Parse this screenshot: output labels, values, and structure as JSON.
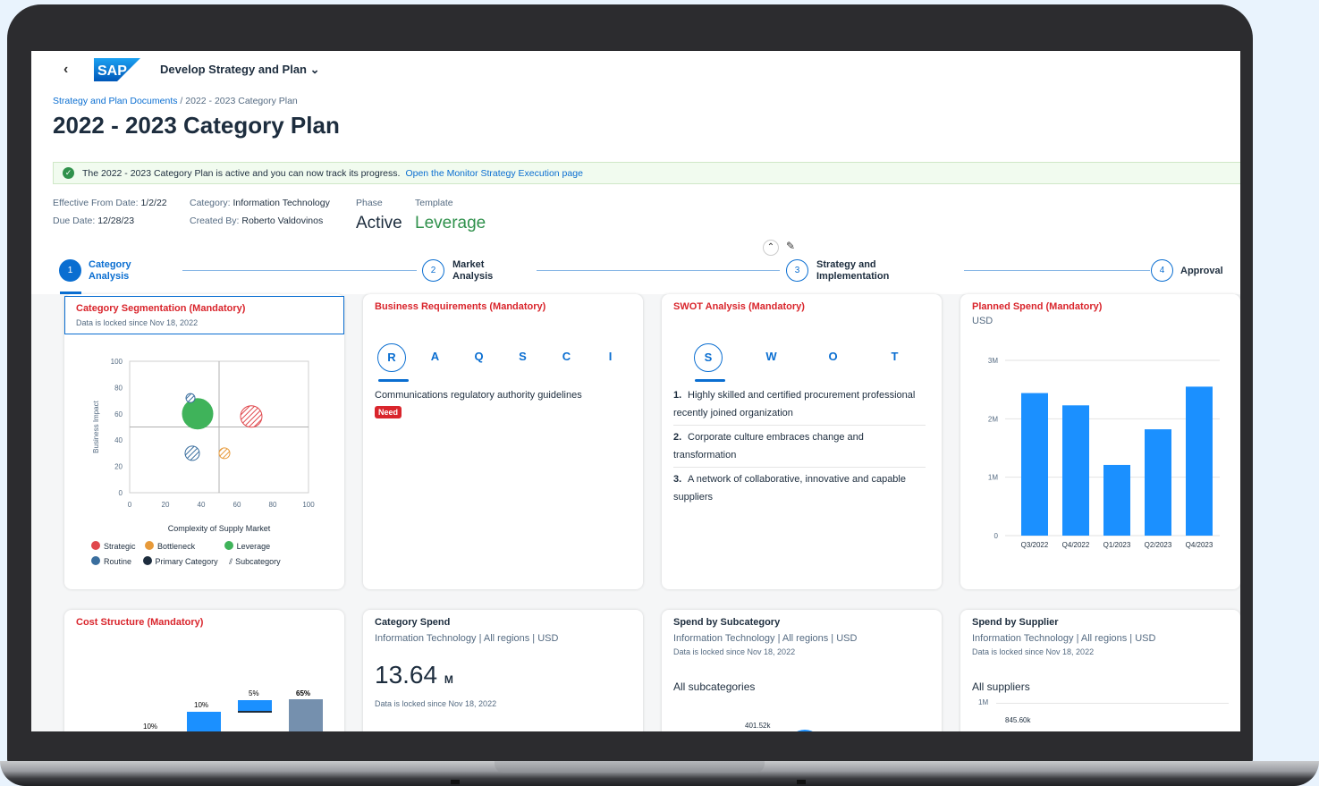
{
  "shell": {
    "back": "‹",
    "logo": "SAP",
    "app_title": "Develop Strategy and Plan ⌄"
  },
  "breadcrumb": {
    "link": "Strategy and Plan Documents",
    "sep": " / ",
    "current": "2022 - 2023 Category Plan"
  },
  "page_title": "2022 - 2023 Category Plan",
  "banner": {
    "text": "The 2022 - 2023 Category Plan is active and you can now track its progress.",
    "link": "Open the Monitor Strategy Execution page"
  },
  "header": {
    "eff_label": "Effective From Date:",
    "eff_value": "1/2/22",
    "due_label": "Due Date:",
    "due_value": "12/28/23",
    "cat_label": "Category:",
    "cat_value": "Information Technology",
    "by_label": "Created By:",
    "by_value": "Roberto Valdovinos",
    "phase_label": "Phase",
    "phase_value": "Active",
    "tmpl_label": "Template",
    "tmpl_value": "Leverage"
  },
  "steps": [
    {
      "num": "1",
      "label1": "Category",
      "label2": "Analysis"
    },
    {
      "num": "2",
      "label1": "Market",
      "label2": "Analysis"
    },
    {
      "num": "3",
      "label1": "Strategy and",
      "label2": "Implementation"
    },
    {
      "num": "4",
      "label1": "Approval",
      "label2": ""
    }
  ],
  "cards": {
    "seg": {
      "title": "Category Segmentation (Mandatory)",
      "sub": "Data is locked since Nov 18, 2022",
      "ylabel": "Business Impact",
      "xlabel": "Complexity of Supply Market",
      "legend": [
        "Strategic",
        "Bottleneck",
        "Leverage",
        "Routine",
        "Primary Category",
        "Subcategory"
      ]
    },
    "biz": {
      "title": "Business Requirements (Mandatory)",
      "tabs": [
        "R",
        "A",
        "Q",
        "S",
        "C",
        "I"
      ],
      "item": "Communications regulatory authority guidelines",
      "badge": "Need"
    },
    "swot": {
      "title": "SWOT Analysis (Mandatory)",
      "tabs": [
        "S",
        "W",
        "O",
        "T"
      ],
      "items": [
        {
          "n": "1.",
          "t": "Highly skilled and certified procurement professional recently joined organization"
        },
        {
          "n": "2.",
          "t": "Corporate culture embraces change and transformation"
        },
        {
          "n": "3.",
          "t": "A network of collaborative, innovative and capable suppliers"
        }
      ]
    },
    "spend": {
      "title": "Planned Spend (Mandatory)",
      "sub": "USD"
    },
    "cost": {
      "title": "Cost Structure (Mandatory)",
      "labels": [
        "10%",
        "10%",
        "5%",
        "65%"
      ]
    },
    "catspend": {
      "title": "Category Spend",
      "sub": "Information Technology | All regions | USD",
      "value": "13.64",
      "unit": "M",
      "lock": "Data is locked since Nov 18, 2022"
    },
    "subcat": {
      "title": "Spend by Subcategory",
      "sub": "Information Technology | All regions | USD",
      "lock": "Data is locked since Nov 18, 2022",
      "label": "All subcategories",
      "val": "401.52k"
    },
    "supplier": {
      "title": "Spend by Supplier",
      "sub": "Information Technology | All regions | USD",
      "lock": "Data is locked since Nov 18, 2022",
      "label": "All suppliers",
      "tick": "1M",
      "val": "845.60k"
    }
  },
  "chart_data": [
    {
      "type": "bar",
      "title": "Planned Spend (Mandatory)",
      "ylabel": "USD",
      "categories": [
        "Q3/2022",
        "Q4/2022",
        "Q1/2023",
        "Q2/2023",
        "Q4/2023"
      ],
      "values": [
        2440000,
        2230000,
        1210000,
        1820000,
        2550000
      ],
      "ylim": [
        0,
        3000000
      ],
      "yticks": [
        "0",
        "1M",
        "2M",
        "3M"
      ],
      "color": "#1b90ff"
    },
    {
      "type": "scatter",
      "title": "Category Segmentation (Mandatory)",
      "xlabel": "Complexity of Supply Market",
      "ylabel": "Business Impact",
      "xlim": [
        0,
        100
      ],
      "ylim": [
        0,
        100
      ],
      "xticks": [
        "0",
        "20",
        "40",
        "60",
        "80",
        "100"
      ],
      "yticks": [
        "0",
        "20",
        "40",
        "60",
        "80",
        "100"
      ],
      "points": [
        {
          "x": 38,
          "y": 60,
          "r": 17,
          "color": "#3fb35a",
          "kind": "Leverage"
        },
        {
          "x": 68,
          "y": 58,
          "r": 12,
          "color": "#e0474c",
          "kind": "Strategic",
          "hatch": true
        },
        {
          "x": 34,
          "y": 72,
          "r": 5,
          "color": "#3a6e9e",
          "kind": "Routine",
          "hatch": true
        },
        {
          "x": 35,
          "y": 30,
          "r": 8,
          "color": "#3a6e9e",
          "kind": "Routine",
          "hatch": true
        },
        {
          "x": 53,
          "y": 30,
          "r": 6,
          "color": "#e79a3a",
          "kind": "Bottleneck",
          "hatch": true
        }
      ]
    }
  ]
}
